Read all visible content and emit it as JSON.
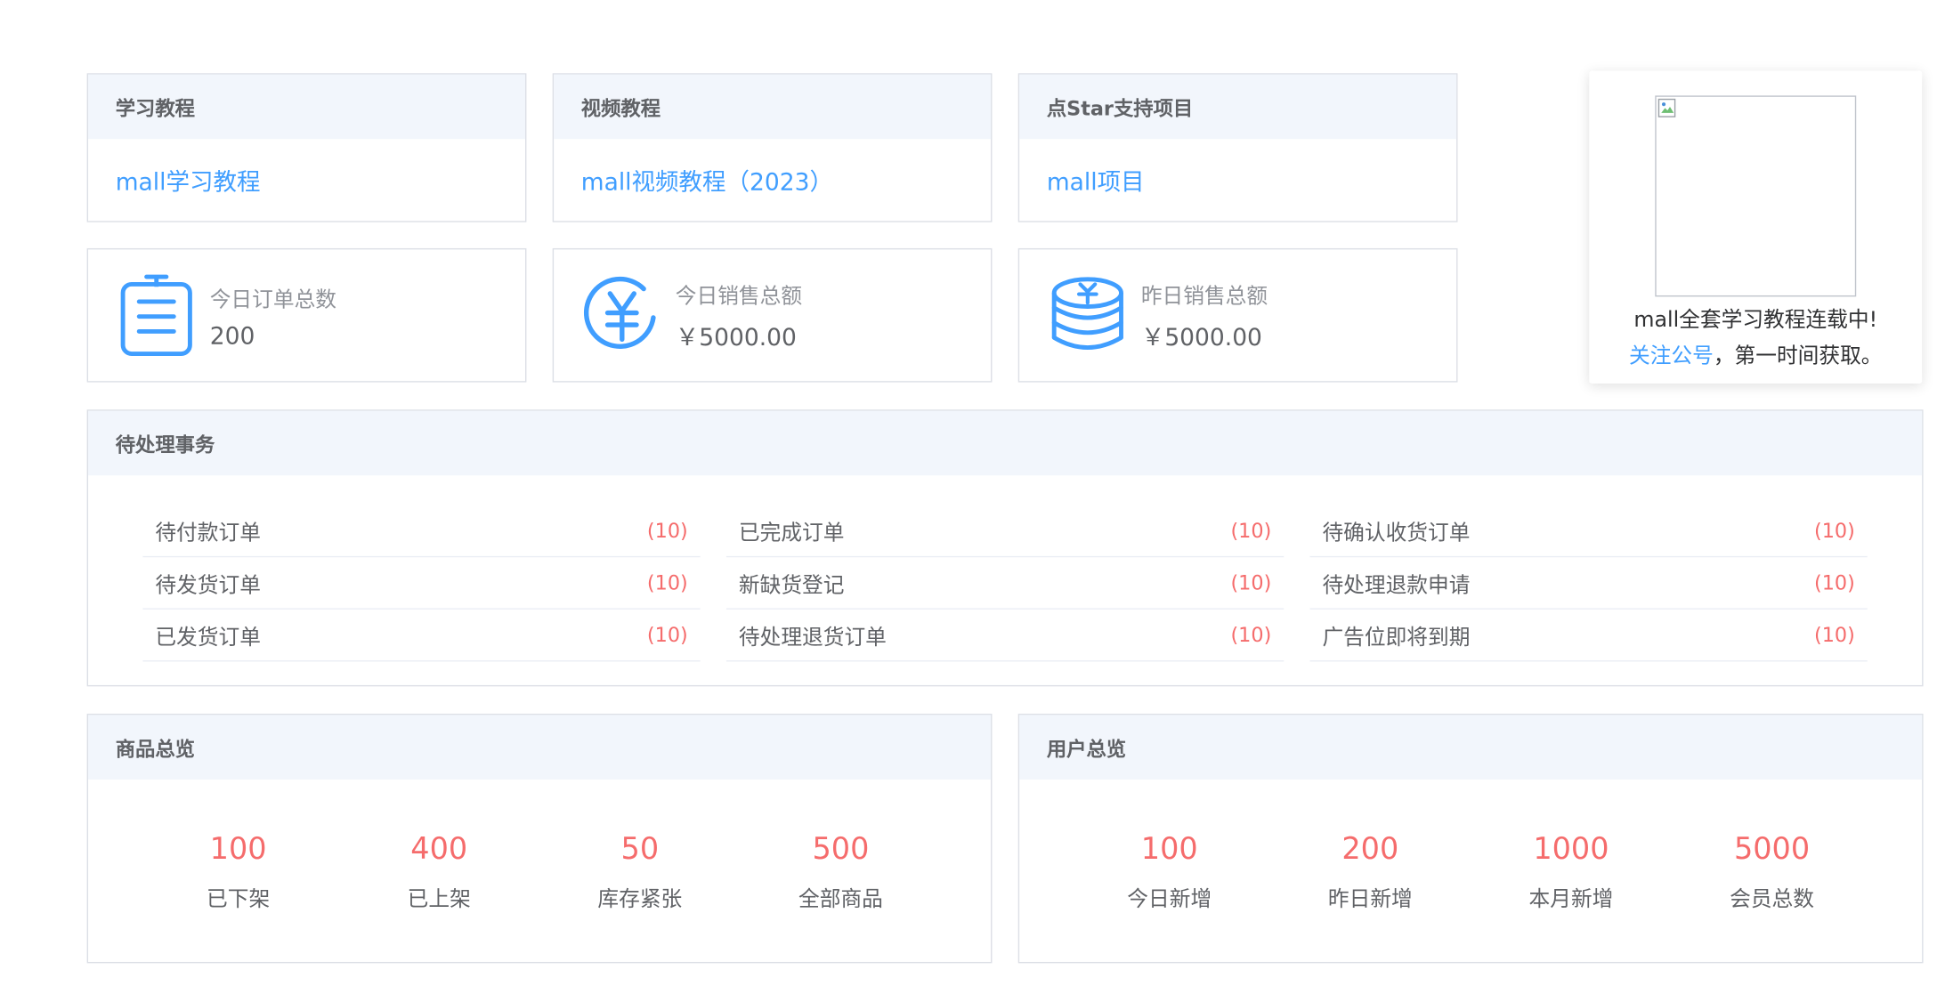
{
  "tutorials": [
    {
      "header": "学习教程",
      "link": "mall学习教程"
    },
    {
      "header": "视频教程",
      "link": "mall视频教程（2023）"
    },
    {
      "header": "点Star支持项目",
      "link": "mall项目"
    }
  ],
  "stats": [
    {
      "label": "今日订单总数",
      "value": "200",
      "icon": "clipboard-icon"
    },
    {
      "label": "今日销售总额",
      "value": "￥5000.00",
      "icon": "yen-circle-icon"
    },
    {
      "label": "昨日销售总额",
      "value": "￥5000.00",
      "icon": "coin-stack-icon"
    }
  ],
  "promo": {
    "line1": "mall全套学习教程连载中!",
    "link": "关注公号",
    "line2_rest": "，第一时间获取。"
  },
  "pending": {
    "header": "待处理事务",
    "columns": [
      [
        {
          "label": "待付款订单",
          "count": "(10)"
        },
        {
          "label": "待发货订单",
          "count": "(10)"
        },
        {
          "label": "已发货订单",
          "count": "(10)"
        }
      ],
      [
        {
          "label": "已完成订单",
          "count": "(10)"
        },
        {
          "label": "新缺货登记",
          "count": "(10)"
        },
        {
          "label": "待处理退货订单",
          "count": "(10)"
        }
      ],
      [
        {
          "label": "待确认收货订单",
          "count": "(10)"
        },
        {
          "label": "待处理退款申请",
          "count": "(10)"
        },
        {
          "label": "广告位即将到期",
          "count": "(10)"
        }
      ]
    ]
  },
  "product_overview": {
    "header": "商品总览",
    "items": [
      {
        "value": "100",
        "label": "已下架"
      },
      {
        "value": "400",
        "label": "已上架"
      },
      {
        "value": "50",
        "label": "库存紧张"
      },
      {
        "value": "500",
        "label": "全部商品"
      }
    ]
  },
  "user_overview": {
    "header": "用户总览",
    "items": [
      {
        "value": "100",
        "label": "今日新增"
      },
      {
        "value": "200",
        "label": "昨日新增"
      },
      {
        "value": "1000",
        "label": "本月新增"
      },
      {
        "value": "5000",
        "label": "会员总数"
      }
    ]
  },
  "colors": {
    "accent": "#409eff",
    "count_red": "#f56c6c",
    "header_bg": "#f2f6fc",
    "border": "#dcdfe6"
  }
}
